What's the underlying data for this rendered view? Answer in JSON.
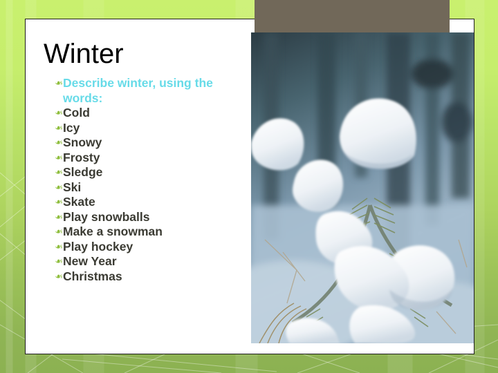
{
  "slide": {
    "title": "Winter",
    "bullet_glyph": "❧",
    "bullet_icon_name": "rotated-floral-heart-bullet"
  },
  "colors": {
    "background_green_top": "#c9f06e",
    "background_green_bottom": "#8cb152",
    "panel_background": "#ffffff",
    "panel_border": "#1d1d1d",
    "top_bar": "#716859",
    "accent_green_bar": "#8cb83a",
    "bullet_marker": "#8fbe3d",
    "heading_text": "#000000",
    "prompt_text": "#67dbe8",
    "body_text": "#3b3b33"
  },
  "bullets": [
    {
      "text": "Describe winter, using the words:",
      "style": "prompt"
    },
    {
      "text": "Cold",
      "style": "body"
    },
    {
      "text": "Icy",
      "style": "body"
    },
    {
      "text": "Snowy",
      "style": "body"
    },
    {
      "text": "Frosty",
      "style": "body"
    },
    {
      "text": "Sledge",
      "style": "body"
    },
    {
      "text": "Ski",
      "style": "body"
    },
    {
      "text": "Skate",
      "style": "body"
    },
    {
      "text": "Play snowballs",
      "style": "body"
    },
    {
      "text": "Make a snowman",
      "style": "body"
    },
    {
      "text": "Play hockey",
      "style": "body"
    },
    {
      "text": "New Year",
      "style": "body"
    },
    {
      "text": "Christmas",
      "style": "body"
    }
  ],
  "photo": {
    "alt": "Snow-covered pine tree branches in a winter forest"
  }
}
